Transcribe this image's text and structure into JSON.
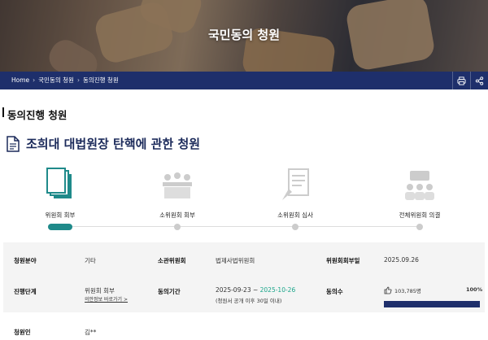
{
  "hero": {
    "title": "국민동의 청원"
  },
  "breadcrumb": [
    "Home",
    "국민동의 청원",
    "동의진행 청원"
  ],
  "section_title": "동의진행 청원",
  "petition_title": "조희대 대법원장 탄핵에 관한 청원",
  "steps": [
    {
      "label": "위원회 회부",
      "icon": "documents-icon",
      "active": true
    },
    {
      "label": "소위원회 회부",
      "icon": "meeting-icon",
      "active": false
    },
    {
      "label": "소위원회 심사",
      "icon": "review-document-icon",
      "active": false
    },
    {
      "label": "전체위원회 의결",
      "icon": "group-icon",
      "active": false
    }
  ],
  "info": {
    "field_label": "청원분야",
    "field_value": "기타",
    "committee_label": "소관위원회",
    "committee_value": "법제사법위원회",
    "referral_date_label": "위원회회부일",
    "referral_date_value": "2025.09.26",
    "stage_label": "진행단계",
    "stage_value": "위원회 회부",
    "stage_link": "의안정보 바로가기 >",
    "period_label": "동의기간",
    "period_start": "2025-09-23 ~ ",
    "period_end": "2025-10-26",
    "period_note": "(청원서 공개 이후 30일 이내)",
    "count_label": "동의수",
    "count_value": "103,785명",
    "progress_text": "100%",
    "progress": 1.0
  },
  "petitioner": {
    "label": "청원인",
    "value": "김**"
  },
  "colors": {
    "nav": "#1e2f6b",
    "accent": "#1f8a8a",
    "green": "#1aa58a"
  }
}
